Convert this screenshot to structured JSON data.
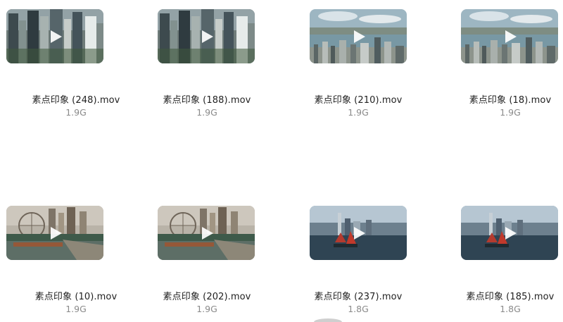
{
  "files": [
    {
      "name": "素点印象 (248).mov",
      "size": "1.9G",
      "thumb": "skyscrapers-thumbnail"
    },
    {
      "name": "素点印象 (188).mov",
      "size": "1.9G",
      "thumb": "skyscrapers-thumbnail"
    },
    {
      "name": "素点印象 (210).mov",
      "size": "1.9G",
      "thumb": "harbor-panorama-thumbnail"
    },
    {
      "name": "素点印象 (18).mov",
      "size": "1.9G",
      "thumb": "harbor-panorama-thumbnail"
    },
    {
      "name": "素点印象 (10).mov",
      "size": "1.9G",
      "thumb": "ferris-wheel-thumbnail"
    },
    {
      "name": "素点印象 (202).mov",
      "size": "1.9G",
      "thumb": "ferris-wheel-thumbnail"
    },
    {
      "name": "素点印象 (237).mov",
      "size": "1.8G",
      "thumb": "junk-boat-thumbnail"
    },
    {
      "name": "素点印象 (185).mov",
      "size": "1.8G",
      "thumb": "junk-boat-thumbnail"
    }
  ],
  "icons": {
    "play": "play-icon"
  },
  "colors": {
    "filename_text": "#1f1f1f",
    "filesize_text": "#8a8a8a",
    "play_icon": "#ffffff"
  }
}
